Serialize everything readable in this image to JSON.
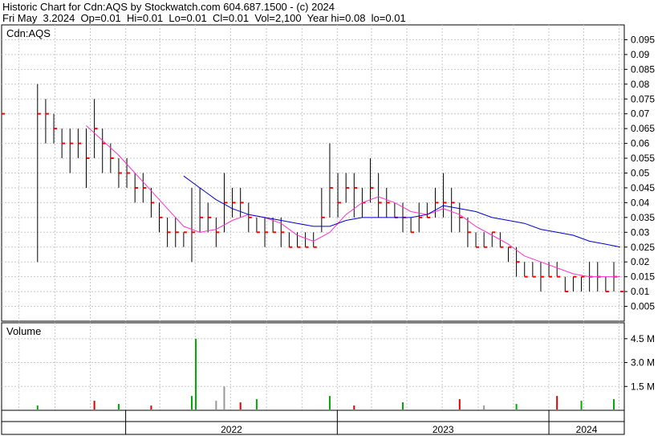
{
  "header": {
    "line1": "Historic Chart for Cdn:AQS by Stockwatch.com 604.687.1500 - (c) 2024",
    "line2": "Fri May  3.2024  Op=0.01  Hi=0.01  Lo=0.01  Cl=0.01  Vol=2,100  Year hi=0.08  lo=0.01"
  },
  "colors": {
    "price_bar": "#000000",
    "close_tick": "#ff0000",
    "ma_short": "#ff33cc",
    "ma_long": "#0000cc",
    "volume_up": "#00aa00",
    "volume_down": "#dd0000",
    "volume_flat": "#999999",
    "grid": "#c8c8c8"
  },
  "chart_data": [
    {
      "type": "bar",
      "name": "price",
      "label": "Cdn:AQS",
      "ylim": [
        0,
        0.1
      ],
      "yticks": [
        "0.005",
        "0.01",
        "0.015",
        "0.02",
        "0.025",
        "0.03",
        "0.035",
        "0.04",
        "0.045",
        "0.05",
        "0.055",
        "0.06",
        "0.065",
        "0.07",
        "0.075",
        "0.08",
        "0.085",
        "0.09",
        "0.095"
      ],
      "xlim": [
        "2021-06-01",
        "2024-05-10"
      ],
      "x_tick_labels": [
        "2022",
        "2023",
        "2024"
      ],
      "x_tick_dates": [
        "2022-01-01",
        "2023-01-01",
        "2024-01-01"
      ],
      "grid": true,
      "bars": [
        {
          "date": "2021-06-01",
          "high": 0.075,
          "low": 0.065,
          "close": 0.07
        },
        {
          "date": "2021-08-02",
          "high": 0.08,
          "low": 0.02,
          "close": 0.07
        },
        {
          "date": "2021-08-16",
          "high": 0.075,
          "low": 0.06,
          "close": 0.07
        },
        {
          "date": "2021-08-30",
          "high": 0.07,
          "low": 0.06,
          "close": 0.065
        },
        {
          "date": "2021-09-13",
          "high": 0.065,
          "low": 0.055,
          "close": 0.06
        },
        {
          "date": "2021-09-27",
          "high": 0.065,
          "low": 0.05,
          "close": 0.06
        },
        {
          "date": "2021-10-11",
          "high": 0.065,
          "low": 0.055,
          "close": 0.06
        },
        {
          "date": "2021-10-25",
          "high": 0.065,
          "low": 0.045,
          "close": 0.055
        },
        {
          "date": "2021-11-08",
          "high": 0.075,
          "low": 0.055,
          "close": 0.065
        },
        {
          "date": "2021-11-22",
          "high": 0.065,
          "low": 0.05,
          "close": 0.06
        },
        {
          "date": "2021-12-06",
          "high": 0.06,
          "low": 0.05,
          "close": 0.055
        },
        {
          "date": "2021-12-20",
          "high": 0.055,
          "low": 0.045,
          "close": 0.05
        },
        {
          "date": "2022-01-03",
          "high": 0.055,
          "low": 0.045,
          "close": 0.05
        },
        {
          "date": "2022-01-17",
          "high": 0.05,
          "low": 0.04,
          "close": 0.045
        },
        {
          "date": "2022-01-31",
          "high": 0.05,
          "low": 0.04,
          "close": 0.045
        },
        {
          "date": "2022-02-14",
          "high": 0.045,
          "low": 0.035,
          "close": 0.04
        },
        {
          "date": "2022-02-28",
          "high": 0.04,
          "low": 0.03,
          "close": 0.035
        },
        {
          "date": "2022-03-14",
          "high": 0.035,
          "low": 0.025,
          "close": 0.03
        },
        {
          "date": "2022-03-28",
          "high": 0.035,
          "low": 0.025,
          "close": 0.03
        },
        {
          "date": "2022-04-11",
          "high": 0.03,
          "low": 0.025,
          "close": 0.03
        },
        {
          "date": "2022-04-25",
          "high": 0.045,
          "low": 0.02,
          "close": 0.03
        },
        {
          "date": "2022-05-09",
          "high": 0.045,
          "low": 0.03,
          "close": 0.035
        },
        {
          "date": "2022-05-23",
          "high": 0.04,
          "low": 0.03,
          "close": 0.035
        },
        {
          "date": "2022-06-06",
          "high": 0.035,
          "low": 0.025,
          "close": 0.03
        },
        {
          "date": "2022-06-20",
          "high": 0.05,
          "low": 0.03,
          "close": 0.04
        },
        {
          "date": "2022-07-04",
          "high": 0.045,
          "low": 0.035,
          "close": 0.04
        },
        {
          "date": "2022-07-18",
          "high": 0.045,
          "low": 0.035,
          "close": 0.04
        },
        {
          "date": "2022-08-01",
          "high": 0.04,
          "low": 0.03,
          "close": 0.035
        },
        {
          "date": "2022-08-15",
          "high": 0.035,
          "low": 0.03,
          "close": 0.03
        },
        {
          "date": "2022-08-29",
          "high": 0.035,
          "low": 0.025,
          "close": 0.03
        },
        {
          "date": "2022-09-12",
          "high": 0.035,
          "low": 0.03,
          "close": 0.03
        },
        {
          "date": "2022-09-26",
          "high": 0.035,
          "low": 0.025,
          "close": 0.03
        },
        {
          "date": "2022-10-10",
          "high": 0.03,
          "low": 0.025,
          "close": 0.025
        },
        {
          "date": "2022-10-24",
          "high": 0.03,
          "low": 0.025,
          "close": 0.025
        },
        {
          "date": "2022-11-07",
          "high": 0.03,
          "low": 0.025,
          "close": 0.025
        },
        {
          "date": "2022-11-21",
          "high": 0.03,
          "low": 0.025,
          "close": 0.025
        },
        {
          "date": "2022-12-05",
          "high": 0.045,
          "low": 0.03,
          "close": 0.035
        },
        {
          "date": "2022-12-19",
          "high": 0.06,
          "low": 0.035,
          "close": 0.045
        },
        {
          "date": "2023-01-02",
          "high": 0.05,
          "low": 0.035,
          "close": 0.04
        },
        {
          "date": "2023-01-16",
          "high": 0.05,
          "low": 0.04,
          "close": 0.045
        },
        {
          "date": "2023-01-30",
          "high": 0.05,
          "low": 0.035,
          "close": 0.045
        },
        {
          "date": "2023-02-13",
          "high": 0.045,
          "low": 0.035,
          "close": 0.04
        },
        {
          "date": "2023-02-27",
          "high": 0.055,
          "low": 0.04,
          "close": 0.045
        },
        {
          "date": "2023-03-13",
          "high": 0.05,
          "low": 0.035,
          "close": 0.04
        },
        {
          "date": "2023-03-27",
          "high": 0.045,
          "low": 0.035,
          "close": 0.04
        },
        {
          "date": "2023-04-10",
          "high": 0.04,
          "low": 0.035,
          "close": 0.035
        },
        {
          "date": "2023-04-24",
          "high": 0.04,
          "low": 0.03,
          "close": 0.035
        },
        {
          "date": "2023-05-08",
          "high": 0.035,
          "low": 0.03,
          "close": 0.03
        },
        {
          "date": "2023-05-22",
          "high": 0.04,
          "low": 0.03,
          "close": 0.035
        },
        {
          "date": "2023-06-05",
          "high": 0.04,
          "low": 0.035,
          "close": 0.035
        },
        {
          "date": "2023-06-19",
          "high": 0.045,
          "low": 0.035,
          "close": 0.04
        },
        {
          "date": "2023-07-03",
          "high": 0.05,
          "low": 0.035,
          "close": 0.04
        },
        {
          "date": "2023-07-17",
          "high": 0.045,
          "low": 0.03,
          "close": 0.04
        },
        {
          "date": "2023-07-31",
          "high": 0.04,
          "low": 0.03,
          "close": 0.035
        },
        {
          "date": "2023-08-14",
          "high": 0.035,
          "low": 0.025,
          "close": 0.03
        },
        {
          "date": "2023-08-28",
          "high": 0.03,
          "low": 0.025,
          "close": 0.025
        },
        {
          "date": "2023-09-11",
          "high": 0.03,
          "low": 0.025,
          "close": 0.025
        },
        {
          "date": "2023-09-25",
          "high": 0.03,
          "low": 0.025,
          "close": 0.03
        },
        {
          "date": "2023-10-09",
          "high": 0.03,
          "low": 0.025,
          "close": 0.025
        },
        {
          "date": "2023-10-23",
          "high": 0.025,
          "low": 0.02,
          "close": 0.025
        },
        {
          "date": "2023-11-06",
          "high": 0.025,
          "low": 0.015,
          "close": 0.02
        },
        {
          "date": "2023-11-20",
          "high": 0.02,
          "low": 0.015,
          "close": 0.015
        },
        {
          "date": "2023-12-04",
          "high": 0.02,
          "low": 0.015,
          "close": 0.015
        },
        {
          "date": "2023-12-18",
          "high": 0.02,
          "low": 0.01,
          "close": 0.015
        },
        {
          "date": "2024-01-01",
          "high": 0.02,
          "low": 0.015,
          "close": 0.015
        },
        {
          "date": "2024-01-15",
          "high": 0.02,
          "low": 0.015,
          "close": 0.015
        },
        {
          "date": "2024-01-29",
          "high": 0.015,
          "low": 0.01,
          "close": 0.01
        },
        {
          "date": "2024-02-12",
          "high": 0.015,
          "low": 0.01,
          "close": 0.015
        },
        {
          "date": "2024-02-26",
          "high": 0.015,
          "low": 0.01,
          "close": 0.015
        },
        {
          "date": "2024-03-11",
          "high": 0.02,
          "low": 0.01,
          "close": 0.015
        },
        {
          "date": "2024-03-25",
          "high": 0.02,
          "low": 0.01,
          "close": 0.015
        },
        {
          "date": "2024-04-08",
          "high": 0.015,
          "low": 0.01,
          "close": 0.01
        },
        {
          "date": "2024-04-22",
          "high": 0.02,
          "low": 0.01,
          "close": 0.015
        },
        {
          "date": "2024-05-03",
          "high": 0.01,
          "low": 0.01,
          "close": 0.01
        }
      ],
      "moving_averages": [
        {
          "role": "short",
          "points": [
            {
              "date": "2021-10-25",
              "value": 0.066
            },
            {
              "date": "2021-11-22",
              "value": 0.061
            },
            {
              "date": "2021-12-20",
              "value": 0.056
            },
            {
              "date": "2022-01-17",
              "value": 0.05
            },
            {
              "date": "2022-02-14",
              "value": 0.044
            },
            {
              "date": "2022-03-14",
              "value": 0.038
            },
            {
              "date": "2022-04-11",
              "value": 0.032
            },
            {
              "date": "2022-05-09",
              "value": 0.03
            },
            {
              "date": "2022-06-06",
              "value": 0.031
            },
            {
              "date": "2022-07-04",
              "value": 0.034
            },
            {
              "date": "2022-08-01",
              "value": 0.036
            },
            {
              "date": "2022-08-29",
              "value": 0.035
            },
            {
              "date": "2022-09-26",
              "value": 0.033
            },
            {
              "date": "2022-10-24",
              "value": 0.029
            },
            {
              "date": "2022-11-21",
              "value": 0.027
            },
            {
              "date": "2022-12-19",
              "value": 0.03
            },
            {
              "date": "2023-01-16",
              "value": 0.036
            },
            {
              "date": "2023-02-13",
              "value": 0.04
            },
            {
              "date": "2023-03-13",
              "value": 0.042
            },
            {
              "date": "2023-04-10",
              "value": 0.04
            },
            {
              "date": "2023-05-08",
              "value": 0.037
            },
            {
              "date": "2023-06-05",
              "value": 0.036
            },
            {
              "date": "2023-07-03",
              "value": 0.038
            },
            {
              "date": "2023-07-31",
              "value": 0.036
            },
            {
              "date": "2023-08-28",
              "value": 0.032
            },
            {
              "date": "2023-09-25",
              "value": 0.029
            },
            {
              "date": "2023-10-23",
              "value": 0.026
            },
            {
              "date": "2023-11-20",
              "value": 0.022
            },
            {
              "date": "2023-12-18",
              "value": 0.02
            },
            {
              "date": "2024-01-15",
              "value": 0.018
            },
            {
              "date": "2024-02-12",
              "value": 0.016
            },
            {
              "date": "2024-03-11",
              "value": 0.015
            },
            {
              "date": "2024-04-08",
              "value": 0.015
            },
            {
              "date": "2024-05-03",
              "value": 0.015
            }
          ]
        },
        {
          "role": "long",
          "points": [
            {
              "date": "2022-04-11",
              "value": 0.049
            },
            {
              "date": "2022-05-09",
              "value": 0.045
            },
            {
              "date": "2022-06-06",
              "value": 0.041
            },
            {
              "date": "2022-07-04",
              "value": 0.038
            },
            {
              "date": "2022-08-01",
              "value": 0.036
            },
            {
              "date": "2022-08-29",
              "value": 0.035
            },
            {
              "date": "2022-09-26",
              "value": 0.034
            },
            {
              "date": "2022-10-24",
              "value": 0.033
            },
            {
              "date": "2022-11-21",
              "value": 0.032
            },
            {
              "date": "2022-12-19",
              "value": 0.032
            },
            {
              "date": "2023-01-16",
              "value": 0.034
            },
            {
              "date": "2023-02-13",
              "value": 0.035
            },
            {
              "date": "2023-03-13",
              "value": 0.035
            },
            {
              "date": "2023-04-10",
              "value": 0.035
            },
            {
              "date": "2023-05-08",
              "value": 0.035
            },
            {
              "date": "2023-06-05",
              "value": 0.036
            },
            {
              "date": "2023-07-03",
              "value": 0.039
            },
            {
              "date": "2023-07-31",
              "value": 0.038
            },
            {
              "date": "2023-08-28",
              "value": 0.037
            },
            {
              "date": "2023-09-25",
              "value": 0.035
            },
            {
              "date": "2023-10-23",
              "value": 0.034
            },
            {
              "date": "2023-11-20",
              "value": 0.033
            },
            {
              "date": "2023-12-18",
              "value": 0.031
            },
            {
              "date": "2024-01-15",
              "value": 0.03
            },
            {
              "date": "2024-02-12",
              "value": 0.029
            },
            {
              "date": "2024-03-11",
              "value": 0.027
            },
            {
              "date": "2024-04-08",
              "value": 0.026
            },
            {
              "date": "2024-05-03",
              "value": 0.025
            }
          ]
        }
      ]
    },
    {
      "type": "bar",
      "name": "volume",
      "label": "Volume",
      "ylim": [
        0,
        5.5
      ],
      "yticks": [
        "1.5 M",
        "3.0 M",
        "4.5 M"
      ],
      "xlim": [
        "2021-06-01",
        "2024-05-10"
      ],
      "bars": [
        {
          "date": "2021-08-02",
          "value": 0.3,
          "dir": "up"
        },
        {
          "date": "2021-11-08",
          "value": 0.6,
          "dir": "down"
        },
        {
          "date": "2021-12-20",
          "value": 0.4,
          "dir": "up"
        },
        {
          "date": "2022-02-14",
          "value": 0.3,
          "dir": "down"
        },
        {
          "date": "2022-04-25",
          "value": 0.9,
          "dir": "up"
        },
        {
          "date": "2022-05-02",
          "value": 4.5,
          "dir": "up"
        },
        {
          "date": "2022-06-06",
          "value": 0.6,
          "dir": "flat"
        },
        {
          "date": "2022-06-20",
          "value": 1.5,
          "dir": "flat"
        },
        {
          "date": "2022-07-18",
          "value": 0.5,
          "dir": "down"
        },
        {
          "date": "2022-08-15",
          "value": 0.7,
          "dir": "up"
        },
        {
          "date": "2022-12-19",
          "value": 0.9,
          "dir": "up"
        },
        {
          "date": "2023-01-30",
          "value": 0.3,
          "dir": "down"
        },
        {
          "date": "2023-04-24",
          "value": 0.5,
          "dir": "up"
        },
        {
          "date": "2023-07-31",
          "value": 0.7,
          "dir": "down"
        },
        {
          "date": "2023-09-11",
          "value": 0.3,
          "dir": "flat"
        },
        {
          "date": "2023-11-06",
          "value": 0.4,
          "dir": "up"
        },
        {
          "date": "2024-01-15",
          "value": 0.9,
          "dir": "down"
        },
        {
          "date": "2024-02-26",
          "value": 0.6,
          "dir": "up"
        },
        {
          "date": "2024-04-22",
          "value": 0.7,
          "dir": "up"
        }
      ]
    }
  ]
}
